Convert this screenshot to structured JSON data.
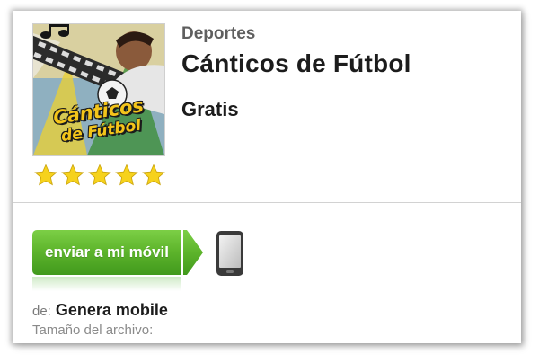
{
  "app": {
    "category": "Deportes",
    "title": "Cánticos de Fútbol",
    "price": "Gratis",
    "icon_text_line1": "Cánticos",
    "icon_text_line2": "de Fútbol",
    "rating": 5,
    "rating_max": 5
  },
  "actions": {
    "send_label": "enviar a mi móvil"
  },
  "meta": {
    "developer_prefix": "de:",
    "developer_name": "Genera mobile",
    "filesize_label": "Tamaño del archivo:"
  },
  "colors": {
    "button_green": "#5db42b",
    "star_yellow": "#f6d21c",
    "icon_dark": "#1b1b1b"
  },
  "icons": {
    "star": "star-icon",
    "phone": "mobile-phone-icon",
    "arrow": "arrow-right-icon"
  }
}
